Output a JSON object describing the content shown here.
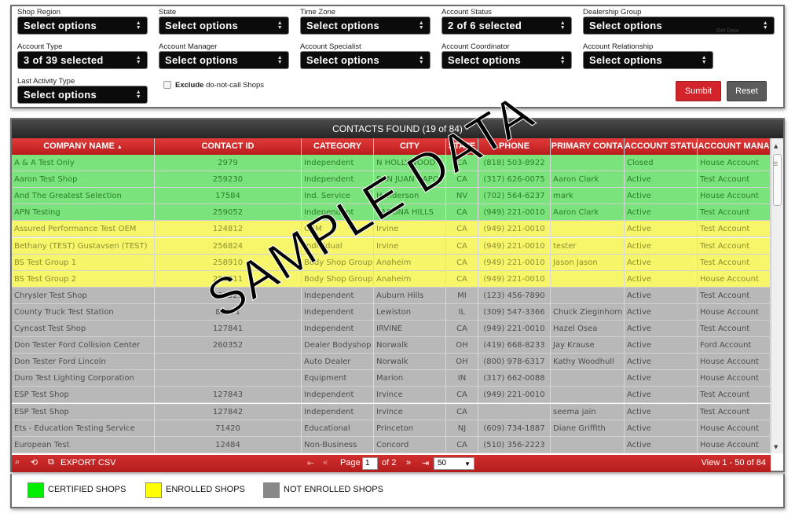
{
  "filters": {
    "shop_region": {
      "label": "Shop Region",
      "value": "Select options"
    },
    "state": {
      "label": "State",
      "value": "Select options"
    },
    "time_zone": {
      "label": "Time Zone",
      "value": "Select options"
    },
    "account_status": {
      "label": "Account Status",
      "value": "2 of 6 selected"
    },
    "dealership_group": {
      "label": "Dealership Group",
      "value": "Select options"
    },
    "account_type": {
      "label": "Account Type",
      "value": "3 of 39 selected"
    },
    "account_manager": {
      "label": "Account Manager",
      "value": "Select options"
    },
    "account_specialist": {
      "label": "Account Specialist",
      "value": "Select options"
    },
    "account_coordinator": {
      "label": "Account Coordinator",
      "value": "Select options"
    },
    "account_relationship": {
      "label": "Account Relationship",
      "value": "Select options"
    },
    "last_activity_type": {
      "label": "Last Activity Type",
      "value": "Select options"
    },
    "exclude_dnc": {
      "label_bold": "Exclude",
      "label_rest": " do-not-call Shops",
      "checked": false
    },
    "stray_text": "Get Data"
  },
  "buttons": {
    "submit": "Sumbit",
    "reset": "Reset"
  },
  "grid": {
    "caption": "CONTACTS FOUND (19 of 84)",
    "columns": [
      "COMPANY NAME",
      "CONTACT ID",
      "CATEGORY",
      "CITY",
      "STATE",
      "PHONE",
      "PRIMARY CONTA",
      "ACCOUNT STATU",
      "ACCOUNT MANA"
    ],
    "sort_indicator": "▲",
    "rows": [
      {
        "status": "certified",
        "cells": [
          "A & A Test Only",
          "2979",
          "Independent",
          "N HOLLYWOOD",
          "CA",
          "(818) 503-8922",
          "",
          "Closed",
          "House Account"
        ]
      },
      {
        "status": "certified",
        "cells": [
          "Aaron Test Shop",
          "259230",
          "Independent",
          "SAN JUAN CAPO",
          "CA",
          "(317) 626-0075",
          "Aaron Clark",
          "Active",
          "Test Account"
        ]
      },
      {
        "status": "certified",
        "cells": [
          "And The Greatest Selection",
          "17584",
          "Ind. Service",
          "Henderson",
          "NV",
          "(702) 564-6237",
          "mark",
          "Active",
          "House Account"
        ]
      },
      {
        "status": "certified",
        "cells": [
          "APN Testing",
          "259052",
          "Independent",
          "LAGUNA HILLS",
          "CA",
          "(949) 221-0010",
          "Aaron Clark",
          "Active",
          "Test Account"
        ]
      },
      {
        "status": "enrolled",
        "cells": [
          "Assured Performance Test OEM",
          "124812",
          "OEM",
          "Irvine",
          "CA",
          "(949) 221-0010",
          "",
          "Active",
          "Test Account"
        ]
      },
      {
        "status": "enrolled",
        "cells": [
          "Bethany (TEST) Gustavsen (TEST)",
          "256824",
          "Individual",
          "Irvine",
          "CA",
          "(949) 221-0010",
          "tester",
          "Active",
          "Test Account"
        ]
      },
      {
        "status": "enrolled",
        "cells": [
          "BS Test Group 1",
          "258910",
          "Body Shop Group",
          "Anaheim",
          "CA",
          "(949) 221-0010",
          "Jason Jason",
          "Active",
          "Test Account"
        ]
      },
      {
        "status": "enrolled",
        "cells": [
          "BS Test Group 2",
          "258911",
          "Body Shop Group",
          "Anaheim",
          "CA",
          "(949) 221-0010",
          "",
          "Active",
          "House Account"
        ]
      },
      {
        "status": "not-enrolled",
        "cells": [
          "Chrysler Test Shop",
          "232323",
          "Independent",
          "Auburn Hills",
          "MI",
          "(123) 456-7890",
          "",
          "Active",
          "Test Account"
        ]
      },
      {
        "status": "not-enrolled",
        "cells": [
          "County Truck Test Station",
          "85971",
          "Independent",
          "Lewiston",
          "IL",
          "(309) 547-3366",
          "Chuck Zieginhorn",
          "Active",
          "House Account"
        ]
      },
      {
        "status": "not-enrolled",
        "cells": [
          "Cyncast Test Shop",
          "127841",
          "Independent",
          "IRVINE",
          "CA",
          "(949) 221-0010",
          "Hazel Osea",
          "Active",
          "Test Account"
        ]
      },
      {
        "status": "not-enrolled",
        "cells": [
          "Don Tester Ford Collision Center",
          "260352",
          "Dealer Bodyshop",
          "Norwalk",
          "OH",
          "(419) 668-8233",
          "Jay Krause",
          "Active",
          "Ford Account"
        ]
      },
      {
        "status": "not-enrolled",
        "cells": [
          "Don Tester Ford Lincoln",
          "",
          "Auto Dealer",
          "Norwalk",
          "OH",
          "(800) 978-6317",
          "Kathy Woodhull",
          "Active",
          "House Account"
        ]
      },
      {
        "status": "not-enrolled",
        "cells": [
          "Duro Test Lighting Corporation",
          "",
          "Equipment",
          "Marion",
          "IN",
          "(317) 662-0088",
          "",
          "Active",
          "House Account"
        ]
      },
      {
        "status": "not-enrolled",
        "cells": [
          "ESP Test Shop",
          "127843",
          "Independent",
          "Irvince",
          "CA",
          "(949) 221-0010",
          "",
          "Active",
          "Test Account"
        ]
      },
      {
        "status": "not-enrolled",
        "cells": [
          "ESP Test Shop",
          "127842",
          "Independent",
          "Irvince",
          "CA",
          "",
          "seema jain",
          "Active",
          "Test Account"
        ]
      },
      {
        "status": "not-enrolled",
        "cells": [
          "Ets - Education Testing Service",
          "71420",
          "Educational",
          "Princeton",
          "NJ",
          "(609) 734-1887",
          "Diane Griffith",
          "Active",
          "House Account"
        ]
      },
      {
        "status": "not-enrolled",
        "cells": [
          "European Test",
          "12484",
          "Non-Business",
          "Concord",
          "CA",
          "(510) 356-2223",
          "",
          "Active",
          "House Account"
        ]
      }
    ]
  },
  "pager": {
    "export_label": "EXPORT CSV",
    "page_label": "Page",
    "page_value": "1",
    "of_label": "of 2",
    "page_size": "50",
    "view_label": "View 1 - 50 of 84"
  },
  "legend": {
    "items": [
      {
        "label": "CERTIFIED SHOPS",
        "color": "#00ee00"
      },
      {
        "label": "ENROLLED SHOPS",
        "color": "#ffff00"
      },
      {
        "label": "NOT ENROLLED SHOPS",
        "color": "#888888"
      }
    ]
  },
  "watermark": "SAMPLE DATA"
}
